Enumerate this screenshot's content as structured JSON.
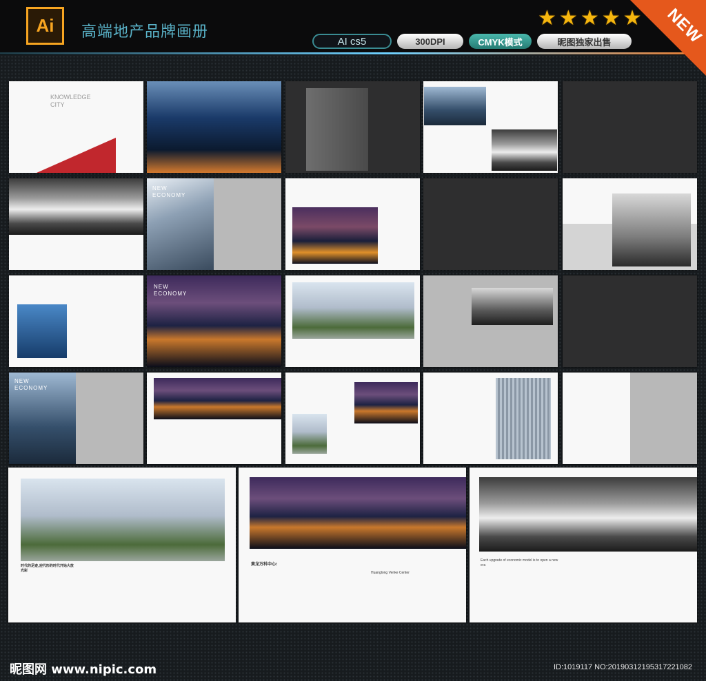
{
  "header": {
    "logo_text": "Ai",
    "title": "高端地产品牌画册",
    "rating_stars": 5,
    "badges": {
      "ai_version": "AI cs5",
      "dpi": "300DPI",
      "color_mode": "CMYK模式",
      "exclusive": "昵图独家出售"
    },
    "corner_label": "NEW"
  },
  "pages": {
    "p1": {
      "title": "KNOWLEDGE CITY"
    },
    "p7": {
      "title": "NEW ECONOMY"
    },
    "p12": {
      "title": "NEW ECONOMY"
    },
    "p16": {
      "title": "NEW ECONOMY"
    },
    "p24_caption": "时代的足迹,迎代形的时代开始大放光彩"
  },
  "spreads": {
    "s2_heading": "黄龙万科中心:",
    "s2_sub": "Huanglong Venke Center",
    "s3_heading": "Each upgrade of economic model is to open a new era"
  },
  "footer": {
    "site": "昵图网 www.nipic.com",
    "id": "ID:1019117 NO:20190312195317221082"
  }
}
